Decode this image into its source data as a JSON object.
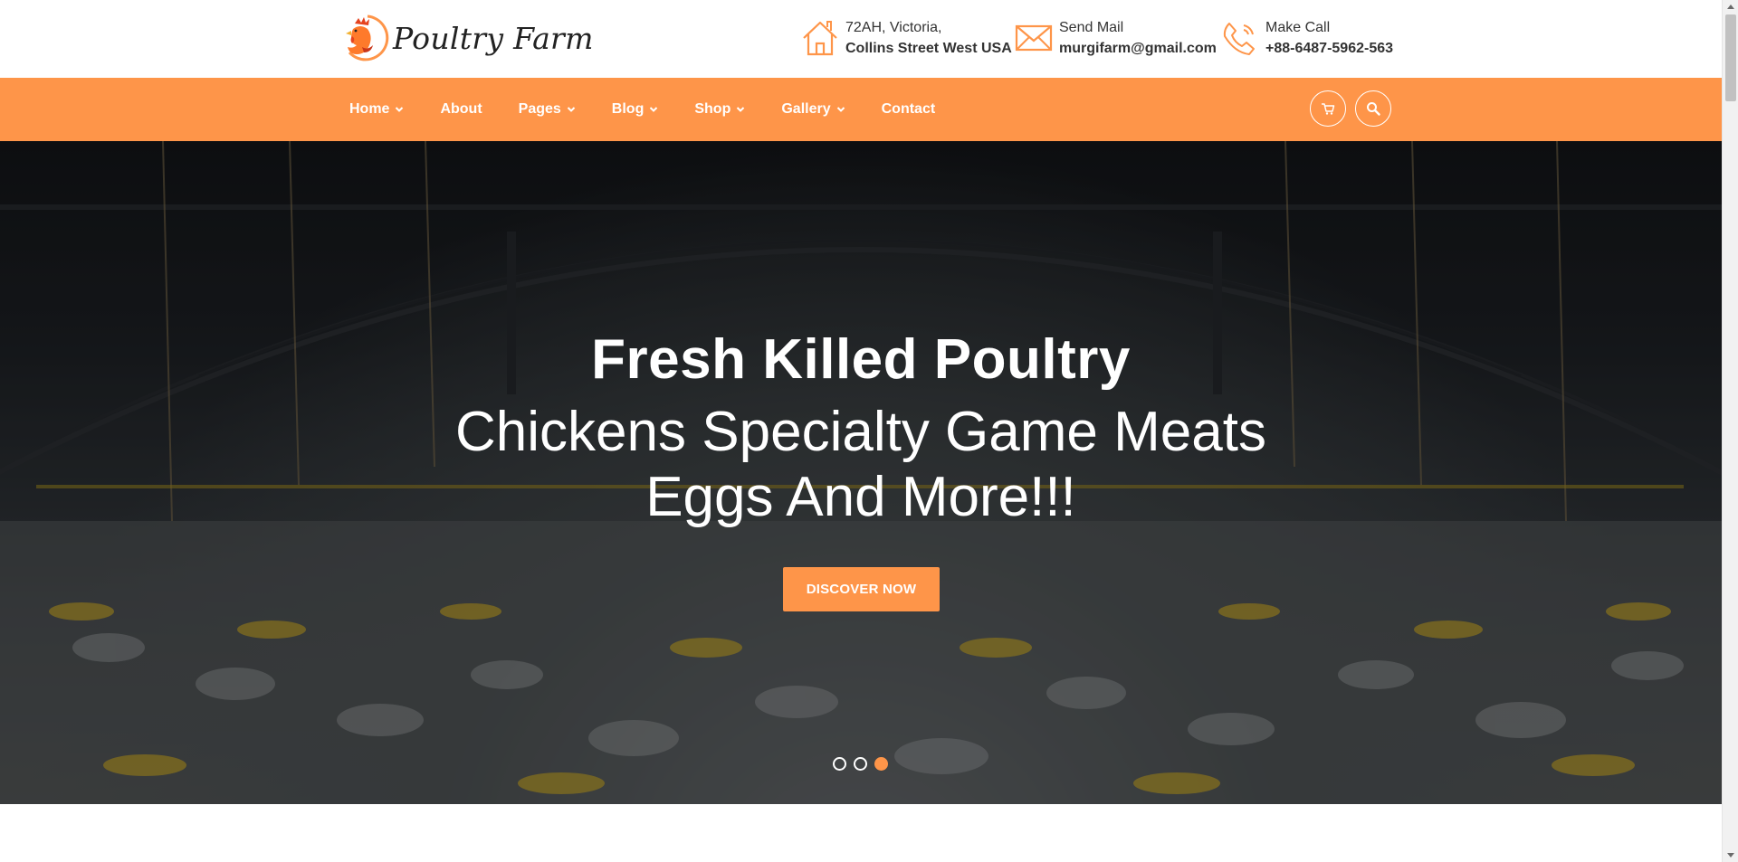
{
  "brand": {
    "name": "Poultry Farm"
  },
  "contact": {
    "address": {
      "line1": "72AH, Victoria,",
      "line2": "Collins Street West USA",
      "icon": "house-icon"
    },
    "mail": {
      "line1": "Send Mail",
      "line2": "murgifarm@gmail.com",
      "icon": "envelope-icon"
    },
    "call": {
      "line1": "Make Call",
      "line2": "+88-6487-5962-563",
      "icon": "phone-icon"
    }
  },
  "nav": {
    "items": [
      {
        "label": "Home",
        "has_dropdown": true
      },
      {
        "label": "About",
        "has_dropdown": false
      },
      {
        "label": "Pages",
        "has_dropdown": true
      },
      {
        "label": "Blog",
        "has_dropdown": true
      },
      {
        "label": "Shop",
        "has_dropdown": true
      },
      {
        "label": "Gallery",
        "has_dropdown": true
      },
      {
        "label": "Contact",
        "has_dropdown": false
      }
    ],
    "cart_icon": "cart-icon",
    "search_icon": "search-icon"
  },
  "hero": {
    "title": "Fresh Killed Poultry",
    "subtitle_line1": "Chickens Specialty Game Meats",
    "subtitle_line2": "Eggs And More!!!",
    "cta_label": "DISCOVER NOW",
    "slides_total": 3,
    "active_slide": 3
  },
  "colors": {
    "accent": "#fe9549",
    "text_dark": "#333333",
    "white": "#ffffff"
  }
}
